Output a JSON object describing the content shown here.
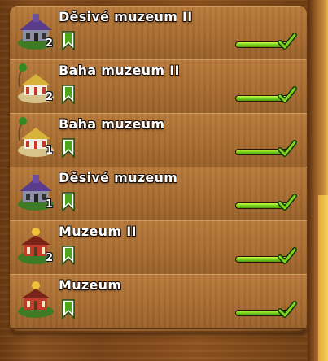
{
  "palette": {
    "accent_green": "#6cc41a",
    "wood_dark": "#5e3412",
    "wood_light": "#b87a3b",
    "text": "#ffffff"
  },
  "items": [
    {
      "name": "Děsivé muzeum II",
      "level": "2",
      "progress": 1.0,
      "thumb": "haunted-museum-icon",
      "ribbon": "bookmark-icon",
      "status": "checkmark-icon"
    },
    {
      "name": "Baha muzeum II",
      "level": "2",
      "progress": 1.0,
      "thumb": "beach-museum-icon",
      "ribbon": "bookmark-icon",
      "status": "checkmark-icon"
    },
    {
      "name": "Baha muzeum",
      "level": "1",
      "progress": 1.0,
      "thumb": "beach-museum-icon",
      "ribbon": "bookmark-icon",
      "status": "checkmark-icon"
    },
    {
      "name": "Děsivé muzeum",
      "level": "1",
      "progress": 1.0,
      "thumb": "haunted-museum-icon",
      "ribbon": "bookmark-icon",
      "status": "checkmark-icon"
    },
    {
      "name": "Muzeum II",
      "level": "2",
      "progress": 1.0,
      "thumb": "museum-icon",
      "ribbon": "bookmark-icon",
      "status": "checkmark-icon"
    },
    {
      "name": "Muzeum",
      "level": "",
      "progress": 1.0,
      "thumb": "museum-icon",
      "ribbon": "bookmark-icon",
      "status": "checkmark-icon"
    }
  ]
}
